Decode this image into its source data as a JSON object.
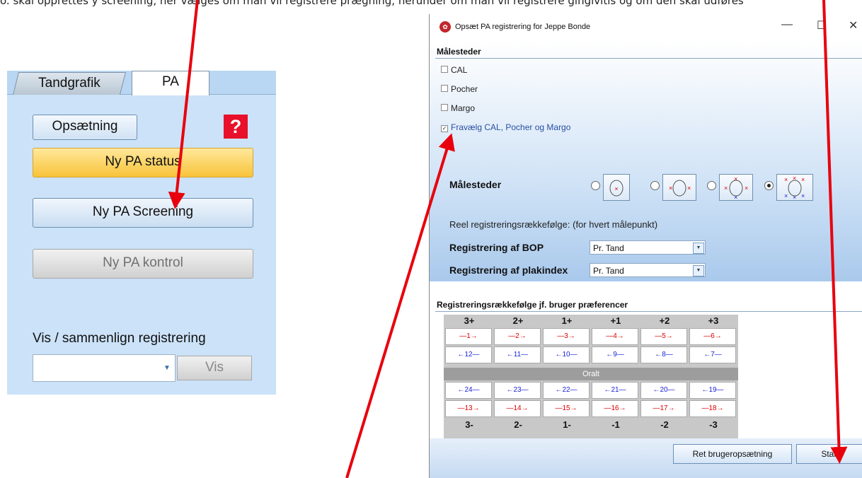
{
  "top_text": "o. skal opprettes y screening, her vælges om man vil registrere prægning, herunder om man vil registrere gingivitis og om den skal udføres",
  "left_panel": {
    "tabs": [
      "Tandgrafik",
      "PA"
    ],
    "setup_button": "Opsætning",
    "help_label": "?",
    "new_status_button": "Ny PA status",
    "new_screening_button": "Ny PA Screening",
    "new_control_button": "Ny PA kontrol",
    "compare_label": "Vis / sammenlign registrering",
    "compare_combo_value": "",
    "show_button": "Vis"
  },
  "dialog": {
    "title": "Opsæt PA registrering for Jeppe Bonde",
    "window_controls": [
      "—",
      "☐",
      "✕"
    ],
    "section1_header": "Målesteder",
    "checkboxes": [
      {
        "label": "CAL",
        "checked": false
      },
      {
        "label": "Pocher",
        "checked": false
      },
      {
        "label": "Margo",
        "checked": false
      },
      {
        "label": "Fravælg CAL, Pocher og Margo",
        "checked": true
      }
    ],
    "malesteder_label": "Målesteder",
    "face_options_selected_index": 3,
    "reel_text": "Reel registreringsrækkefølge:  (for hvert målepunkt)",
    "bop_label": "Registrering af BOP",
    "bop_value": "Pr. Tand",
    "plak_label": "Registrering af plakindex",
    "plak_value": "Pr. Tand",
    "section2_header": "Registreringsrækkefølge jf. bruger præferencer",
    "top_headers": [
      "3+",
      "2+",
      "1+",
      "+1",
      "+2",
      "+3"
    ],
    "bottom_headers": [
      "3-",
      "2-",
      "1-",
      "-1",
      "-2",
      "-3"
    ],
    "row1": [
      "—1→",
      "—2→",
      "—3→",
      "—4→",
      "—5→",
      "—6→"
    ],
    "row2": [
      "←12—",
      "←11—",
      "←10—",
      "←9—",
      "←8—",
      "←7—"
    ],
    "oralt_label": "Oralt",
    "row3": [
      "←24—",
      "←23—",
      "←22—",
      "←21—",
      "←20—",
      "←19—"
    ],
    "row4": [
      "—13→",
      "—14→",
      "—15→",
      "—16→",
      "—17→",
      "—18→"
    ],
    "edit_button": "Ret brugeropsætning",
    "start_button": "Start"
  },
  "colors": {
    "arrow_red": "#e8000d",
    "status_yellow": "#f8c33a",
    "panel_blue": "#cbe2f8"
  }
}
